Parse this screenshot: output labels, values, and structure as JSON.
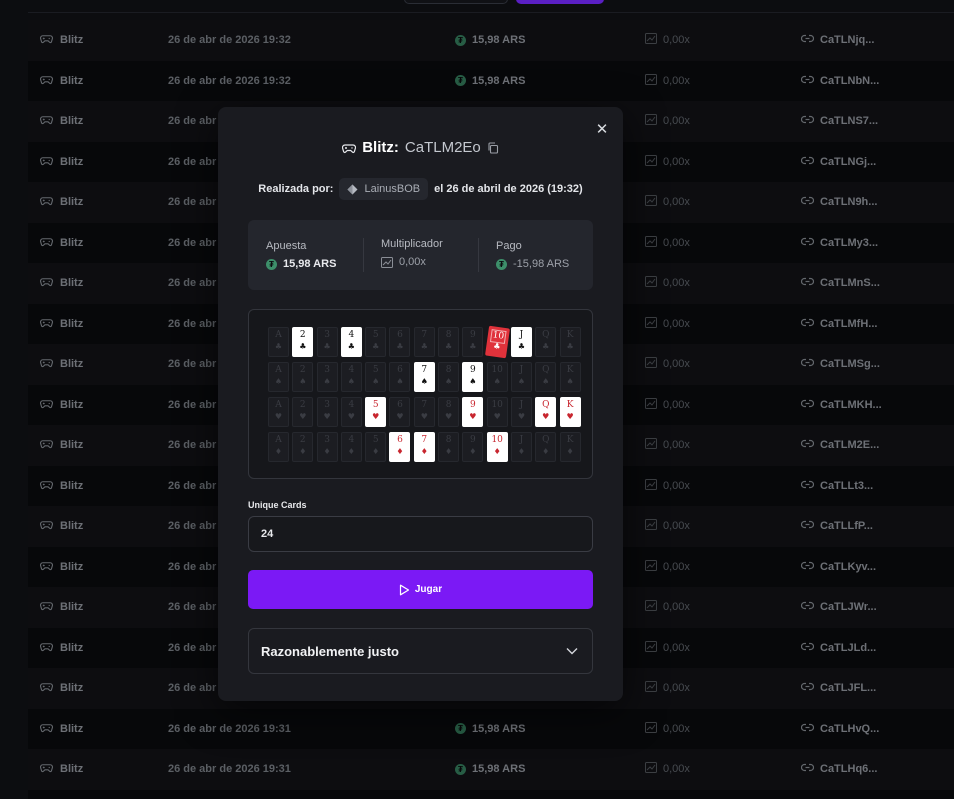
{
  "rows": [
    {
      "game": "Blitz",
      "date": "26 de abr de 2026 19:32",
      "amount": "15,98 ARS",
      "mult": "0,00x",
      "id": "CaTLNjq..."
    },
    {
      "game": "Blitz",
      "date": "26 de abr de 2026 19:32",
      "amount": "15,98 ARS",
      "mult": "0,00x",
      "id": "CaTLNbN..."
    },
    {
      "game": "Blitz",
      "date": "26 de abr",
      "amount": "",
      "mult": "0,00x",
      "id": "CaTLNS7..."
    },
    {
      "game": "Blitz",
      "date": "26 de abr",
      "amount": "",
      "mult": "0,00x",
      "id": "CaTLNGj..."
    },
    {
      "game": "Blitz",
      "date": "26 de abr",
      "amount": "",
      "mult": "0,00x",
      "id": "CaTLN9h..."
    },
    {
      "game": "Blitz",
      "date": "26 de abr",
      "amount": "",
      "mult": "0,00x",
      "id": "CaTLMy3..."
    },
    {
      "game": "Blitz",
      "date": "26 de abr",
      "amount": "",
      "mult": "0,00x",
      "id": "CaTLMnS..."
    },
    {
      "game": "Blitz",
      "date": "26 de abr",
      "amount": "",
      "mult": "0,00x",
      "id": "CaTLMfH..."
    },
    {
      "game": "Blitz",
      "date": "26 de abr",
      "amount": "",
      "mult": "0,00x",
      "id": "CaTLMSg..."
    },
    {
      "game": "Blitz",
      "date": "26 de abr",
      "amount": "",
      "mult": "0,00x",
      "id": "CaTLMKH..."
    },
    {
      "game": "Blitz",
      "date": "26 de abr",
      "amount": "",
      "mult": "0,00x",
      "id": "CaTLM2E..."
    },
    {
      "game": "Blitz",
      "date": "26 de abr",
      "amount": "",
      "mult": "0,00x",
      "id": "CaTLLt3..."
    },
    {
      "game": "Blitz",
      "date": "26 de abr",
      "amount": "",
      "mult": "0,00x",
      "id": "CaTLLfP..."
    },
    {
      "game": "Blitz",
      "date": "26 de abr",
      "amount": "",
      "mult": "0,00x",
      "id": "CaTLKyv..."
    },
    {
      "game": "Blitz",
      "date": "26 de abr",
      "amount": "",
      "mult": "0,00x",
      "id": "CaTLJWr..."
    },
    {
      "game": "Blitz",
      "date": "26 de abr",
      "amount": "",
      "mult": "0,00x",
      "id": "CaTLJLd..."
    },
    {
      "game": "Blitz",
      "date": "26 de abr",
      "amount": "",
      "mult": "0,00x",
      "id": "CaTLJFL..."
    },
    {
      "game": "Blitz",
      "date": "26 de abr de 2026 19:31",
      "amount": "15,98 ARS",
      "mult": "0,00x",
      "id": "CaTLHvQ..."
    },
    {
      "game": "Blitz",
      "date": "26 de abr de 2026 19:31",
      "amount": "15,98 ARS",
      "mult": "0,00x",
      "id": "CaTLHq6..."
    }
  ],
  "modal": {
    "game": "Blitz:",
    "bet_id": "CaTLM2Eo",
    "by_label": "Realizada por:",
    "user": "LainusBOB",
    "date_text": "el 26 de abril de 2026 (19:32)",
    "stats": {
      "bet_label": "Apuesta",
      "bet_value": "15,98 ARS",
      "mult_label": "Multiplicador",
      "mult_value": "0,00x",
      "pay_label": "Pago",
      "pay_value": "-15,98 ARS"
    },
    "unique_label": "Unique Cards",
    "unique_value": "24",
    "play_label": "Jugar",
    "fair_label": "Razonablemente justo"
  },
  "board": {
    "ranks": [
      "A",
      "2",
      "3",
      "4",
      "5",
      "6",
      "7",
      "8",
      "9",
      "10",
      "J",
      "Q",
      "K"
    ],
    "suits": [
      "♣",
      "♠",
      "♥",
      "♦"
    ],
    "active": [
      [
        false,
        true,
        false,
        true,
        false,
        false,
        false,
        false,
        false,
        "tilt",
        true,
        false,
        false
      ],
      [
        false,
        false,
        false,
        false,
        false,
        false,
        true,
        false,
        true,
        false,
        false,
        false,
        false
      ],
      [
        false,
        false,
        false,
        false,
        true,
        false,
        false,
        false,
        true,
        false,
        false,
        true,
        true
      ],
      [
        false,
        false,
        false,
        false,
        false,
        true,
        true,
        false,
        false,
        true,
        false,
        false,
        false
      ]
    ]
  },
  "colors": {
    "accent": "#7b19f5",
    "tether": "#3d8f6a",
    "red_card": "#e0323b"
  }
}
